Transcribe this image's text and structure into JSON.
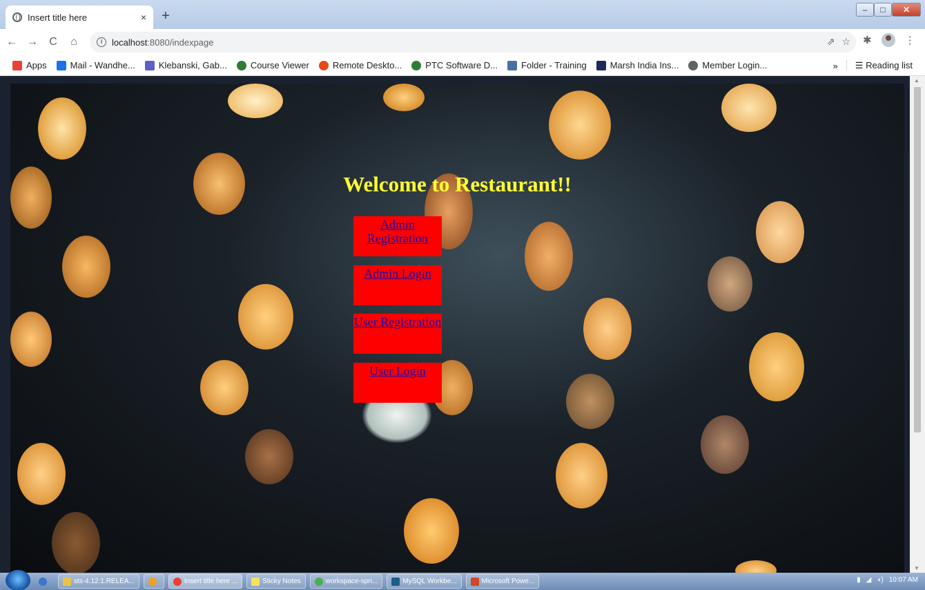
{
  "browser": {
    "tab_title": "Insert title here",
    "tab_close": "×",
    "new_tab": "+",
    "window_controls": {
      "minimize": "–",
      "maximize": "□",
      "close": "✕"
    },
    "nav": {
      "back": "←",
      "forward": "→",
      "reload": "C",
      "home": "⌂"
    },
    "address": {
      "info": "i",
      "host": "localhost",
      "path": ":8080/indexpage"
    },
    "omni_icons": {
      "share": "⇗",
      "star": "☆"
    },
    "toolbar_icons": {
      "extensions": "✱",
      "menu": "⋮"
    }
  },
  "bookmarks": {
    "items": [
      {
        "label": "Apps",
        "color": "#e94235"
      },
      {
        "label": "Mail - Wandhe...",
        "color": "#1a73e8"
      },
      {
        "label": "Klebanski, Gab...",
        "color": "#5b5fc7"
      },
      {
        "label": "Course Viewer",
        "color": "#2e7d32"
      },
      {
        "label": "Remote Deskto...",
        "color": "#e64a19"
      },
      {
        "label": "PTC Software D...",
        "color": "#2e7d32"
      },
      {
        "label": "Folder - Training",
        "color": "#4a6fa5"
      },
      {
        "label": "Marsh India Ins...",
        "color": "#1b2a5c"
      },
      {
        "label": "Member Login...",
        "color": "#5f6368"
      }
    ],
    "more": "»",
    "reading_list": "Reading list"
  },
  "page": {
    "title": "Welcome to Restaurant!!",
    "links": [
      {
        "label": "Admin Registration"
      },
      {
        "label": "Admin Login"
      },
      {
        "label": "User Registration"
      },
      {
        "label": "User Login"
      }
    ],
    "title_color": "#ffff33",
    "box_color": "#ff0000"
  },
  "taskbar": {
    "items": [
      {
        "label": "",
        "color": "#3a78c9"
      },
      {
        "label": "sts-4.12.1.RELEA...",
        "color": "#e8c34a"
      },
      {
        "label": "",
        "color": "#f0a020"
      },
      {
        "label": "Insert title here ...",
        "color": "#e94235"
      },
      {
        "label": "Sticky Notes",
        "color": "#f6e05e"
      },
      {
        "label": "workspace-spri...",
        "color": "#4caf50"
      },
      {
        "label": "MySQL Workbe...",
        "color": "#1b5e8a"
      },
      {
        "label": "Microsoft Powe...",
        "color": "#d24726"
      }
    ],
    "clock": "10:07 AM"
  }
}
